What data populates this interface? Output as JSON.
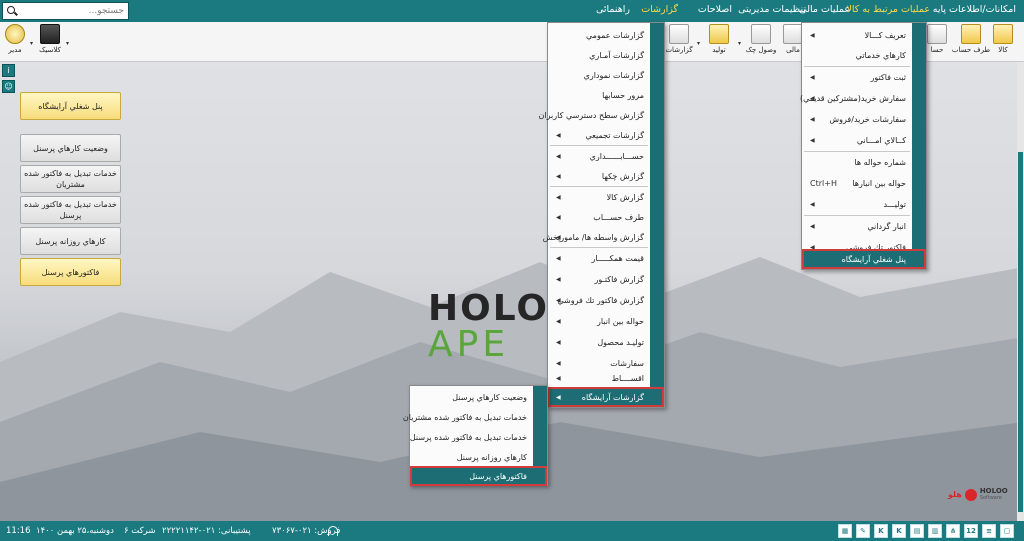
{
  "search": {
    "placeholder": "جستجو..."
  },
  "menubar": {
    "items": [
      "امکانات/اطلاعات پایه",
      "عملیات مرتبط به کالا",
      "عملیات مالی",
      "تنظیمات مدیریتی",
      "اصلاحات",
      "گزارشات",
      "راهنمائی"
    ]
  },
  "toolbar": {
    "buttons": [
      "کالا",
      "طرف حساب",
      "حسا",
      "مالی",
      "وصول چک",
      "تولید",
      "گزارشات",
      "کلاسیک",
      "مدیر"
    ]
  },
  "quick_panel": {
    "title": "پنل شغلي آرايشگاه",
    "buttons": [
      "وضعيت كارهاي پرسنل",
      "خدمات تبديل به فاكتور شده مشتريان",
      "خدمات تبديل به فاكتور شده پرسنل",
      "كارهاي روزانه پرسنل",
      "فاكتورهاي پرسنل"
    ]
  },
  "logo": {
    "line1": "HOLO",
    "line2": "APE"
  },
  "brand": {
    "name": "HOLOO",
    "sub": "Software",
    "fa": "هلو"
  },
  "goods_menu": {
    "items": [
      {
        "label": "تعريف كـــالا",
        "arrow": true
      },
      {
        "label": "كارهاي خدماتي",
        "arrow": false
      },
      {
        "label": "ثبت فاكتور",
        "arrow": true
      },
      {
        "label": "سفارش خريد(مشتركين قديمي)",
        "arrow": true
      },
      {
        "label": "سفارشات خريد/فروش",
        "arrow": true
      },
      {
        "label": "كــالاي امـــاني",
        "arrow": true
      },
      {
        "label": "شماره حواله ها",
        "arrow": false
      },
      {
        "label": "حواله بين انبارها",
        "arrow": false,
        "shortcut": "Ctrl+H"
      },
      {
        "label": "توليـــد",
        "arrow": true
      },
      {
        "label": "انبار گرداني",
        "arrow": true
      },
      {
        "label": "فاكتور تك فروشي",
        "arrow": true
      },
      {
        "label": "پنل شغلي آرايشگاه",
        "arrow": false
      }
    ]
  },
  "reports_menu": {
    "items": [
      {
        "label": "گزارشات عمومي",
        "arrow": false
      },
      {
        "label": "گزارشات آمـاري",
        "arrow": false
      },
      {
        "label": "گزارشات نموداري",
        "arrow": false
      },
      {
        "label": "مرور حسابها",
        "arrow": false
      },
      {
        "label": "گزارش سطح دسترسي كاربران",
        "arrow": false
      },
      {
        "label": "گزارشات تجميعي",
        "arrow": true
      },
      {
        "label": "حســـابــــــداري",
        "arrow": true
      },
      {
        "label": "گزارش چكها",
        "arrow": true
      },
      {
        "label": "گزارش كالا",
        "arrow": true
      },
      {
        "label": "طرف حســـاب",
        "arrow": true
      },
      {
        "label": "گزارش واسطه ها/ مامورپخش",
        "arrow": true
      },
      {
        "label": "قيمت همكـــــار",
        "arrow": true
      },
      {
        "label": "گزارش فاكتـور",
        "arrow": true
      },
      {
        "label": "گزارش فاكتور تك فروشي",
        "arrow": true
      },
      {
        "label": "حواله بين انبار",
        "arrow": true
      },
      {
        "label": "توليـد محصول",
        "arrow": true
      },
      {
        "label": "سفارشات",
        "arrow": true
      },
      {
        "label": "اقســــاط",
        "arrow": true
      },
      {
        "label": "گزارشات آرايشگاه",
        "arrow": true
      }
    ]
  },
  "salon_menu": {
    "items": [
      "وضعيت كارهاي پرسنل",
      "خدمات تبديل به فاكتور شده مشتريان",
      "خدمات تبديل به فاكتور شده پرسنل",
      "كارهاي روزانه پرسنل",
      "فاكتورهاي پرسنل"
    ]
  },
  "statusbar": {
    "time": "11:16",
    "date": "دوشنبه،۲۵ بهمن ۱۴۰۰",
    "company": "شرکت ۶",
    "support": "پشتیبانی: ۰۲۱-۲۲۲۲۱۱۴۲",
    "sales": "فروش: ۰۲۱-۷۳۰۶۷",
    "icons": [
      "12",
      "K",
      "K"
    ]
  },
  "colors": {
    "accent": "#1a7a80",
    "highlight_border": "#d23b3b",
    "active_menu": "#ffd84a"
  }
}
